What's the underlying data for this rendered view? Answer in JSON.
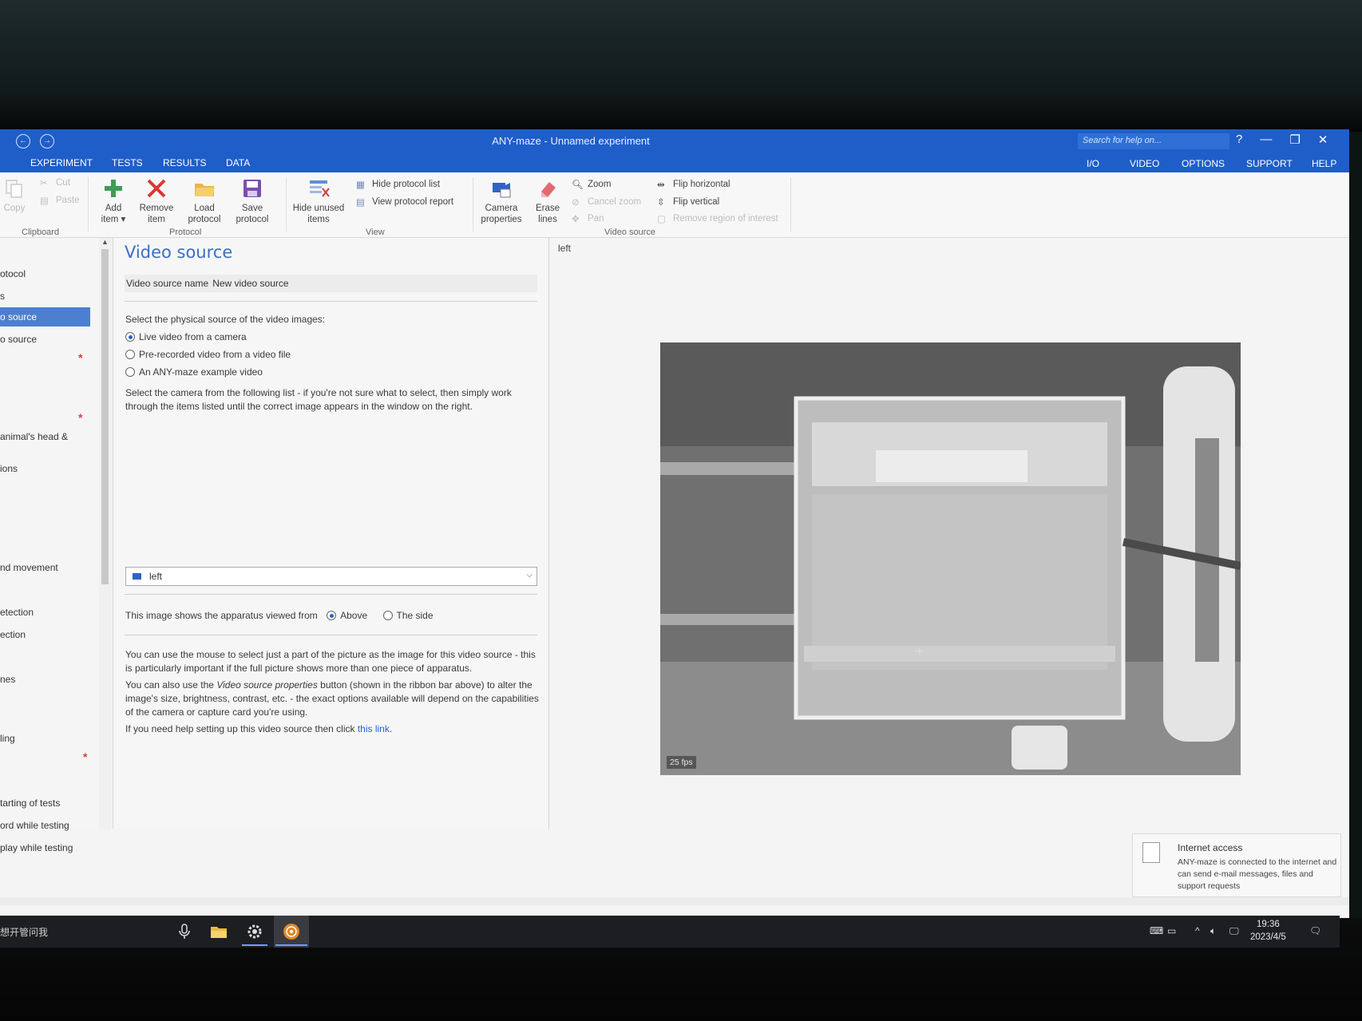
{
  "window": {
    "title": "ANY-maze - Unnamed experiment",
    "search_placeholder": "Search for help on...",
    "help_glyph": "?",
    "minimize_glyph": "—",
    "restore_glyph": "❐",
    "close_glyph": "✕"
  },
  "tabs": {
    "left": [
      "EXPERIMENT",
      "TESTS",
      "RESULTS",
      "DATA"
    ],
    "right": [
      "I/O",
      "VIDEO",
      "OPTIONS",
      "SUPPORT",
      "HELP"
    ]
  },
  "ribbon": {
    "clipboard": {
      "copy": "Copy",
      "cut": "Cut",
      "paste": "Paste",
      "label": "Clipboard"
    },
    "protocol": {
      "add_item_1": "Add",
      "add_item_2": "item ▾",
      "remove_item_1": "Remove",
      "remove_item_2": "item",
      "load_protocol_1": "Load",
      "load_protocol_2": "protocol",
      "save_protocol_1": "Save",
      "save_protocol_2": "protocol",
      "label": "Protocol"
    },
    "view": {
      "hide_unused_1": "Hide unused",
      "hide_unused_2": "items",
      "hide_protocol_list": "Hide protocol list",
      "view_protocol_report": "View protocol report",
      "label": "View"
    },
    "video_source": {
      "camera_properties_1": "Camera",
      "camera_properties_2": "properties",
      "erase_lines_1": "Erase",
      "erase_lines_2": "lines",
      "zoom": "Zoom",
      "cancel_zoom": "Cancel zoom",
      "pan": "Pan",
      "flip_horizontal": "Flip horizontal",
      "flip_vertical": "Flip vertical",
      "remove_roi": "Remove region of interest",
      "label": "Video source"
    }
  },
  "nav": {
    "items": [
      "otocol",
      "s",
      "o source",
      "o source",
      "animal's head &",
      "ions",
      "nd movement",
      "etection",
      "ection",
      "nes",
      "ling",
      "tarting of tests",
      "ord while testing",
      "play while testing"
    ],
    "asterisk": "*"
  },
  "main": {
    "title": "Video source",
    "name_label": "Video source name",
    "name_value": "New video source",
    "physical_source_prompt": "Select the physical source of the video images:",
    "options": [
      "Live video from a camera",
      "Pre-recorded video from a video file",
      "An ANY-maze example video"
    ],
    "camera_prompt": "Select the camera from the following list - if you're not sure what to select, then simply work through the items listed until the correct image appears in the window on the right.",
    "camera_selected": "left",
    "viewed_from_label": "This image shows the apparatus viewed from",
    "viewed_from_options": [
      "Above",
      "The side"
    ],
    "help_para1": "You can use the mouse to select just a part of the picture as the image for this video source - this is particularly important if the full picture shows more than one piece of apparatus.",
    "help_para2_a": "You can also use the ",
    "help_para2_em": "Video source properties",
    "help_para2_b": " button (shown in the ribbon bar above) to alter the image's size, brightness, contrast, etc. - the exact options available will depend on the capabilities of the camera or capture card you're using.",
    "help_para3_a": "If you need help setting up this video source then click ",
    "help_para3_link": "this link",
    "help_para3_b": "."
  },
  "preview": {
    "label": "left",
    "fps": "25 fps"
  },
  "notification": {
    "title": "Internet access",
    "body": "ANY-maze is connected to the internet and can send e-mail messages, files and support requests"
  },
  "taskbar": {
    "search_text": "想开管问我",
    "time": "19:36",
    "date": "2023/4/5"
  }
}
